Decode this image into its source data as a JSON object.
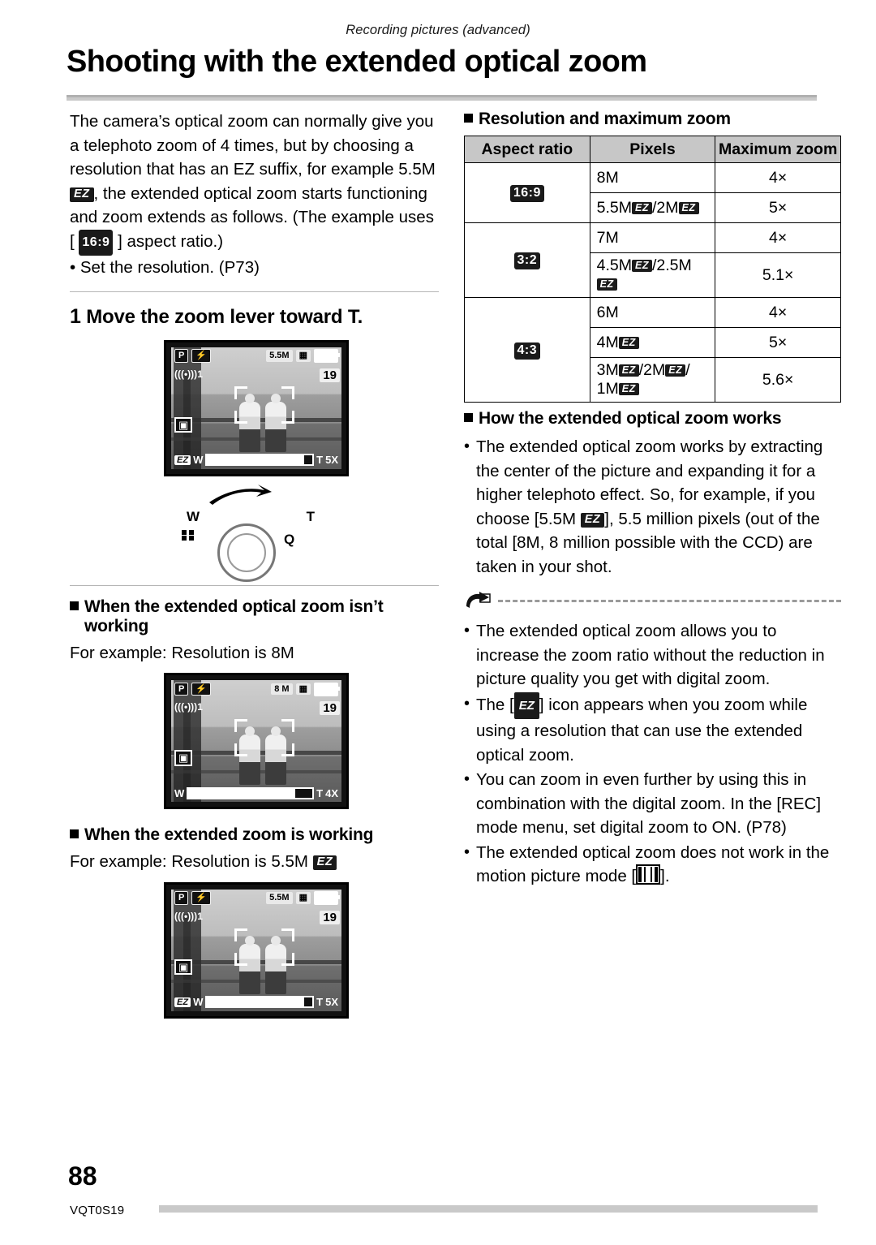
{
  "running_head": "Recording pictures (advanced)",
  "title": "Shooting with the extended optical zoom",
  "left": {
    "intro_1": "The camera’s optical zoom can normally give you a telephoto zoom of 4 times, but by choosing a resolution that has an EZ suffix, for example 5.5M ",
    "intro_ez": "EZ",
    "intro_2": ", the extended optical zoom starts functioning and zoom extends as follows. (The example uses [ ",
    "intro_ratio": "16:9",
    "intro_3": " ] aspect ratio.)",
    "set_resolution": "• Set the resolution. (P73)",
    "step_num": "1",
    "step_text": "Move the zoom lever toward T.",
    "cam1": {
      "mode": "P",
      "flash": "⚡",
      "res_chip": "5.5M",
      "shots": "19",
      "stab": "1",
      "zoom_ez": "EZ",
      "zoom_w": "W",
      "zoom_t": "T",
      "zoom_factor": "5X"
    },
    "lever": {
      "w": "W",
      "t": "T",
      "q": "Q"
    },
    "sub1_line1": "When the extended optical zoom isn’t",
    "sub1_line2": "working",
    "sub1_example": "For example: Resolution is 8M",
    "cam2": {
      "mode": "P",
      "flash": "⚡",
      "res_chip": "8 M",
      "shots": "19",
      "stab": "1",
      "zoom_w": "W",
      "zoom_t": "T",
      "zoom_factor": "4X"
    },
    "sub2": "When the extended zoom is working",
    "sub2_example_a": "For example: Resolution is 5.5M ",
    "sub2_example_ez": "EZ",
    "cam3": {
      "mode": "P",
      "flash": "⚡",
      "res_chip": "5.5M",
      "shots": "19",
      "stab": "1",
      "zoom_ez": "EZ",
      "zoom_w": "W",
      "zoom_t": "T",
      "zoom_factor": "5X"
    }
  },
  "right": {
    "table_heading": "Resolution and maximum zoom",
    "table": {
      "headers": [
        "Aspect ratio",
        "Pixels",
        "Maximum zoom"
      ],
      "groups": [
        {
          "ratio": "16:9",
          "rows": [
            {
              "pixels": [
                {
                  "t": "8M"
                }
              ],
              "zoom": "4×"
            },
            {
              "pixels": [
                {
                  "t": "5.5M"
                },
                {
                  "ez": true
                },
                {
                  "t": "/2M"
                },
                {
                  "ez": true
                }
              ],
              "zoom": "5×"
            }
          ]
        },
        {
          "ratio": "3:2",
          "rows": [
            {
              "pixels": [
                {
                  "t": "7M"
                }
              ],
              "zoom": "4×"
            },
            {
              "pixels": [
                {
                  "t": "4.5M"
                },
                {
                  "ez": true
                },
                {
                  "t": "/2.5M"
                },
                {
                  "ez": true
                }
              ],
              "zoom": "5.1×"
            }
          ]
        },
        {
          "ratio": "4:3",
          "rows": [
            {
              "pixels": [
                {
                  "t": "6M"
                }
              ],
              "zoom": "4×"
            },
            {
              "pixels": [
                {
                  "t": "4M"
                },
                {
                  "ez": true
                }
              ],
              "zoom": "5×"
            },
            {
              "pixels": [
                {
                  "t": "3M"
                },
                {
                  "ez": true
                },
                {
                  "t": "/2M"
                },
                {
                  "ez": true
                },
                {
                  "t": "/"
                },
                {
                  "br": true
                },
                {
                  "t": "1M"
                },
                {
                  "ez": true
                }
              ],
              "zoom": "5.6×"
            }
          ]
        }
      ]
    },
    "how_heading": "How the extended optical zoom works",
    "how_text_a": "The extended optical zoom works by extracting the center of the picture and expanding it for a higher telephoto effect. So, for example, if you choose [5.5M ",
    "how_text_ez": "EZ",
    "how_text_b": "], 5.5 million pixels (out of the total [8M, 8 million possible with the CCD) are taken in your shot.",
    "notes": [
      {
        "parts": [
          {
            "t": "The extended optical zoom allows you to increase the zoom ratio without the reduction in picture quality you get with digital zoom."
          }
        ]
      },
      {
        "parts": [
          {
            "t": "The ["
          },
          {
            "ez": true
          },
          {
            "t": "] icon appears when you zoom while using a resolution that can use the extended optical zoom."
          }
        ]
      },
      {
        "parts": [
          {
            "t": "You can zoom in even further by using this in combination with the digital zoom. In the [REC] mode menu, set digital zoom to ON. (P78)"
          }
        ]
      },
      {
        "parts": [
          {
            "t": "The extended optical zoom does not work in the motion picture mode ["
          },
          {
            "movie": true
          },
          {
            "t": "]."
          }
        ]
      }
    ]
  },
  "footer": {
    "page_number": "88",
    "doc_code": "VQT0S19"
  }
}
